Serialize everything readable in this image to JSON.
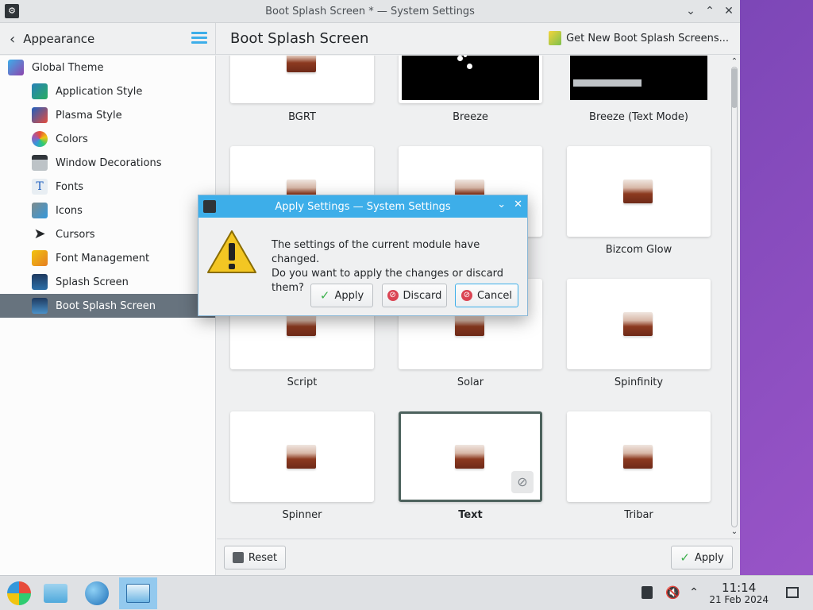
{
  "window": {
    "title": "Boot Splash Screen * — System Settings",
    "controls": [
      "⌄",
      "⌃",
      "✕"
    ]
  },
  "header": {
    "breadcrumb": "Appearance",
    "page_title": "Boot Splash Screen",
    "get_new_label": "Get New Boot Splash Screens..."
  },
  "sidebar": {
    "items": [
      {
        "label": "Global Theme"
      },
      {
        "label": "Application Style"
      },
      {
        "label": "Plasma Style"
      },
      {
        "label": "Colors"
      },
      {
        "label": "Window Decorations"
      },
      {
        "label": "Fonts"
      },
      {
        "label": "Icons"
      },
      {
        "label": "Cursors"
      },
      {
        "label": "Font Management"
      },
      {
        "label": "Splash Screen"
      },
      {
        "label": "Boot Splash Screen",
        "selected": true
      }
    ]
  },
  "themes": [
    {
      "label": "BGRT"
    },
    {
      "label": "Breeze"
    },
    {
      "label": "Breeze (Text Mode)"
    },
    {
      "label": ""
    },
    {
      "label": ""
    },
    {
      "label": "Bizcom Glow"
    },
    {
      "label": "Script"
    },
    {
      "label": "Solar"
    },
    {
      "label": "Spinfinity"
    },
    {
      "label": "Spinner"
    },
    {
      "label": "Text",
      "selected": true
    },
    {
      "label": "Tribar"
    }
  ],
  "footer": {
    "reset_label": "Reset",
    "apply_label": "Apply"
  },
  "dialog": {
    "title": "Apply Settings — System Settings",
    "message_line1": "The settings of the current module have changed.",
    "message_line2": "Do you want to apply the changes or discard them?",
    "apply_label": "Apply",
    "discard_label": "Discard",
    "cancel_label": "Cancel"
  },
  "taskbar": {
    "time": "11:14",
    "date": "21 Feb 2024"
  },
  "colors": {
    "accent": "#3daee9",
    "selection": "#67737e"
  }
}
